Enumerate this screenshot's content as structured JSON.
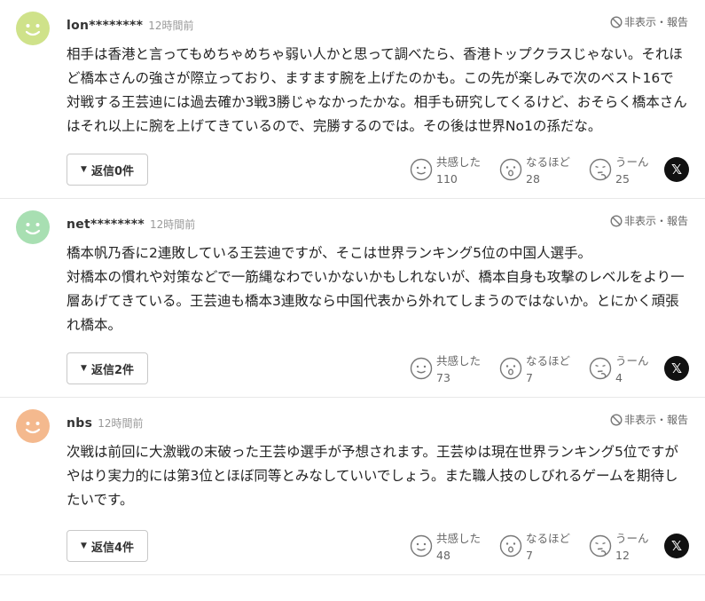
{
  "comments": [
    {
      "user": "lon********",
      "time": "12時間前",
      "hide_report": "非表示・報告",
      "avatar_color": "#cfe28a",
      "text": "相手は香港と言ってもめちゃめちゃ弱い人かと思って調べたら、香港トップクラスじゃない。それほど橋本さんの強さが際立っており、ますます腕を上げたのかも。この先が楽しみで次のベスト16で対戦する王芸迪には過去確か3戦3勝じゃなかったかな。相手も研究してくるけど、おそらく橋本さんはそれ以上に腕を上げてきているので、完勝するのでは。その後は世界No1の孫だな。",
      "reply": "返信0件",
      "reactions": [
        {
          "label": "共感した",
          "count": "110"
        },
        {
          "label": "なるほど",
          "count": "28"
        },
        {
          "label": "うーん",
          "count": "25"
        }
      ]
    },
    {
      "user": "net********",
      "time": "12時間前",
      "hide_report": "非表示・報告",
      "avatar_color": "#a8dfb2",
      "text": "橋本帆乃香に2連敗している王芸迪ですが、そこは世界ランキング5位の中国人選手。\n対橋本の慣れや対策などで一筋縄なわでいかないかもしれないが、橋本自身も攻撃のレベルをより一層あげてきている。王芸迪も橋本3連敗なら中国代表から外れてしまうのではないか。とにかく頑張れ橋本。",
      "reply": "返信2件",
      "reactions": [
        {
          "label": "共感した",
          "count": "73"
        },
        {
          "label": "なるほど",
          "count": "7"
        },
        {
          "label": "うーん",
          "count": "4"
        }
      ]
    },
    {
      "user": "nbs",
      "time": "12時間前",
      "hide_report": "非表示・報告",
      "avatar_color": "#f4b98e",
      "text": "次戦は前回に大激戦の末破った王芸ゆ選手が予想されます。王芸ゆは現在世界ランキング5位ですがやはり実力的には第3位とほぼ同等とみなしていいでしょう。また職人技のしびれるゲームを期待したいです。",
      "reply": "返信4件",
      "reactions": [
        {
          "label": "共感した",
          "count": "48"
        },
        {
          "label": "なるほど",
          "count": "7"
        },
        {
          "label": "うーん",
          "count": "12"
        }
      ]
    }
  ],
  "x_label": "𝕏",
  "icons": {
    "hide": "no-entry-icon",
    "reply": "triangle-down-icon",
    "reaction_1": "thumbs-up-face-icon",
    "reaction_2": "surprised-face-icon",
    "reaction_3": "thinking-face-icon",
    "share": "x-logo-icon"
  }
}
